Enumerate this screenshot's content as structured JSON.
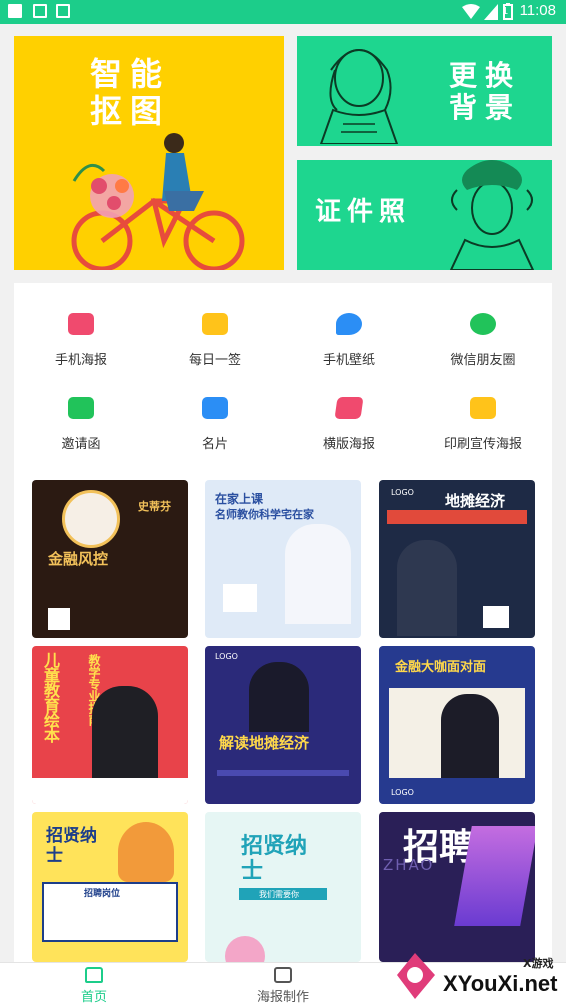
{
  "status_bar": {
    "time": "11:08",
    "battery": "1"
  },
  "banners": {
    "cutout": {
      "title_line1": "智能",
      "title_line2": "抠图",
      "color": "#ffd000"
    },
    "background": {
      "title_line1": "更换",
      "title_line2": "背景",
      "color": "#1ed68f"
    },
    "id_photo": {
      "title": "证件照",
      "color": "#1ed68f"
    }
  },
  "categories": [
    {
      "label": "手机海报",
      "icon": "phone-poster-icon",
      "color": "#f04a6e"
    },
    {
      "label": "每日一签",
      "icon": "daily-sign-icon",
      "color": "#ffc31a"
    },
    {
      "label": "手机壁纸",
      "icon": "wallpaper-icon",
      "color": "#2b8ef5"
    },
    {
      "label": "微信朋友圈",
      "icon": "wechat-moments-icon",
      "color": "#21c35a"
    },
    {
      "label": "邀请函",
      "icon": "invitation-icon",
      "color": "#21c35a"
    },
    {
      "label": "名片",
      "icon": "business-card-icon",
      "color": "#2b8ef5"
    },
    {
      "label": "横版海报",
      "icon": "landscape-poster-icon",
      "color": "#f04a6e"
    },
    {
      "label": "印刷宣传海报",
      "icon": "print-poster-icon",
      "color": "#ffc31a"
    }
  ],
  "templates": [
    {
      "heading": "金融风控",
      "sub": "史蒂芬",
      "bg": "#2b1a12",
      "fg": "#f2c15a"
    },
    {
      "heading": "在家上课",
      "sub": "名师教你科学宅在家",
      "bg": "#dfeaf7",
      "fg": "#2a4fa0"
    },
    {
      "heading": "地摊经济",
      "sub": "LOGO",
      "bg": "#1e2a45",
      "fg": "#ffffff"
    },
    {
      "heading": "儿童教育绘本",
      "sub": "教学专业指南",
      "bg": "#e8434a",
      "fg": "#ffe14d"
    },
    {
      "heading": "解读地摊经济",
      "sub": "LOGO",
      "bg": "#2b2a7a",
      "fg": "#ffd84a"
    },
    {
      "heading": "金融大咖面对面",
      "sub": "LOGO",
      "bg": "#263a8f",
      "fg": "#ffd84a"
    },
    {
      "heading": "招贤纳士",
      "sub": "招聘岗位",
      "bg": "#ffe35a",
      "fg": "#1d3e8a"
    },
    {
      "heading": "招贤纳士",
      "sub": "我们需要你",
      "bg": "#e6f6f4",
      "fg": "#20a3b8"
    },
    {
      "heading": "招聘",
      "sub": "ZHAO",
      "bg": "#2a1f57",
      "fg": "#ffffff"
    }
  ],
  "bottom_nav": [
    {
      "label": "首页",
      "icon": "home-icon",
      "active": true
    },
    {
      "label": "海报制作",
      "icon": "poster-make-icon",
      "active": false
    }
  ],
  "watermark": {
    "text": "XYouXi.net",
    "small": "X游戏"
  },
  "colors": {
    "accent": "#1ccd8a",
    "active_nav": "#1ccd8a"
  }
}
